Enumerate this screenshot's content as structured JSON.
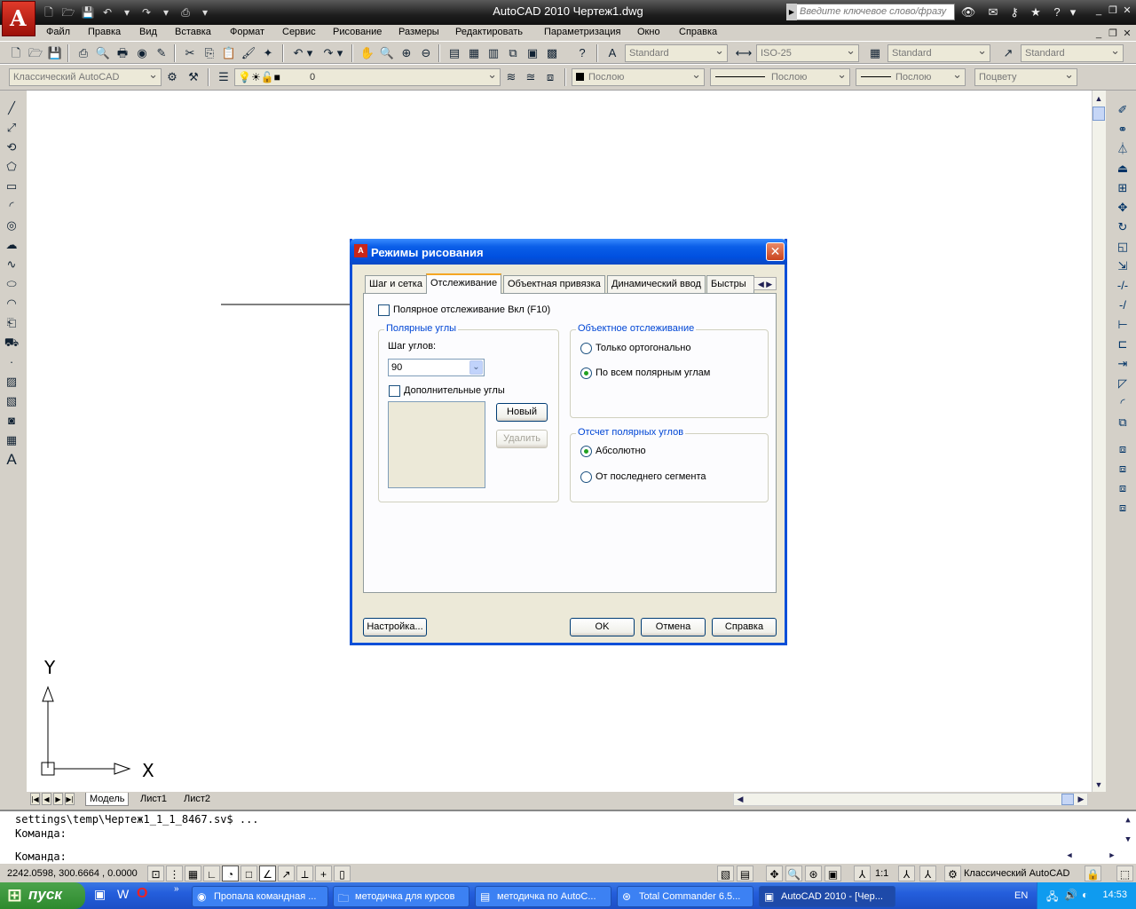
{
  "window": {
    "title": "AutoCAD 2010    Чертеж1.dwg",
    "search_placeholder": "Введите ключевое слово/фразу"
  },
  "menu": [
    "Файл",
    "Правка",
    "Вид",
    "Вставка",
    "Формат",
    "Сервис",
    "Рисование",
    "Размеры",
    "Редактировать",
    "Параметризация",
    "Окно",
    "Справка"
  ],
  "toolbar1": {
    "text_style": "Standard",
    "dim_style": "ISO-25",
    "table_style": "Standard",
    "mleader_style": "Standard"
  },
  "toolbar2": {
    "workspace": "Классический AutoCAD",
    "layer": "0",
    "color": "Послою",
    "linetype": "Послою",
    "lineweight": "Послою",
    "plotstyle": "Поцвету"
  },
  "tabs": {
    "model": "Модель",
    "sheet1": "Лист1",
    "sheet2": "Лист2"
  },
  "command": {
    "line1": "settings\\temp\\Чертеж1_1_1_8467.sv$ ...",
    "line2": "Команда:",
    "prompt": "Команда:"
  },
  "status": {
    "coords": "2242.0598, 300.6664 , 0.0000",
    "scale": "1:1",
    "workspace": "Классический AutoCAD"
  },
  "ucs": {
    "y": "Y",
    "x": "X"
  },
  "dialog": {
    "title": "Режимы рисования",
    "tabs": [
      "Шаг и сетка",
      "Отслеживание",
      "Объектная привязка",
      "Динамический ввод",
      "Быстры"
    ],
    "polar_on": "Полярное отслеживание Вкл (F10)",
    "polar_group": "Полярные углы",
    "angle_step_label": "Шаг углов:",
    "angle_value": "90",
    "extra_angles": "Дополнительные углы",
    "new_btn": "Новый",
    "delete_btn": "Удалить",
    "object_group": "Объектное отслеживание",
    "ortho_only": "Только ортогонально",
    "all_polar": "По всем полярным углам",
    "measure_group": "Отсчет полярных углов",
    "absolute": "Абсолютно",
    "relative": "От последнего сегмента",
    "settings_btn": "Настройка...",
    "ok_btn": "OK",
    "cancel_btn": "Отмена",
    "help_btn": "Справка"
  },
  "taskbar": {
    "start": "пуск",
    "tasks": [
      "Пропала командная ...",
      "методичка для курсов",
      "методичка по AutoC...",
      "Total Commander 6.5...",
      "AutoCAD 2010 - [Чер..."
    ],
    "lang": "EN",
    "clock": "14:53"
  }
}
